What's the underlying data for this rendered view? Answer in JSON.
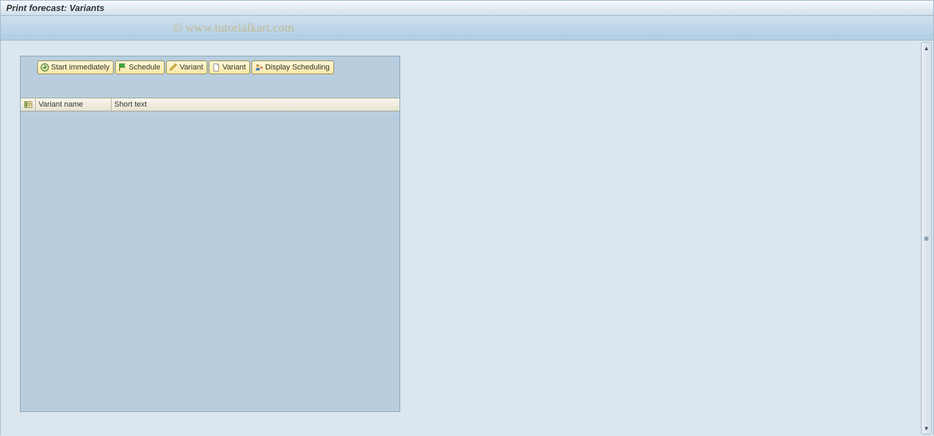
{
  "title": "Print forecast: Variants",
  "watermark": "© www.tutorialkart.com",
  "toolbar": {
    "start_immediately": "Start immediately",
    "schedule": "Schedule",
    "variant_edit": "Variant",
    "variant_new": "Variant",
    "display_scheduling": "Display Scheduling"
  },
  "table": {
    "columns": {
      "variant_name": "Variant name",
      "short_text": "Short text"
    },
    "rows": []
  }
}
